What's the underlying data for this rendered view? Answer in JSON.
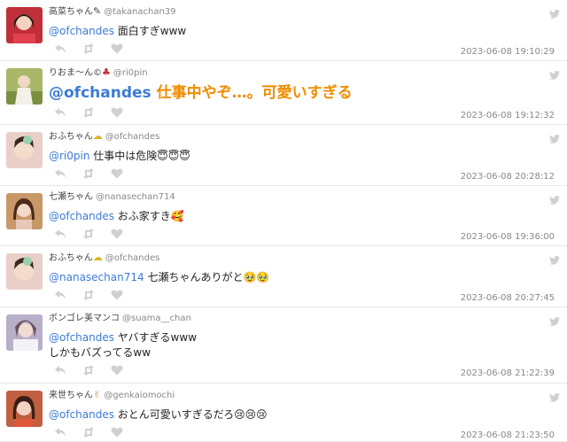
{
  "tweets": [
    {
      "name": "高菜ちゃん",
      "name_emoji": "✎",
      "handle": "@takanachan39",
      "mention": "@ofchandes",
      "text": " 面白すぎwww",
      "time": "2023-06-08 19:10:29",
      "avatar_color": "#c0303a"
    },
    {
      "name": "りおま〜ん©",
      "name_emoji": "♣",
      "handle": "@ri0pin",
      "mention": "@ofchandes",
      "text": " 仕事中やぞ…。可愛いすぎる",
      "time": "2023-06-08 19:12:32",
      "avatar_color": "#a8b868"
    },
    {
      "name": "おふちゃん",
      "name_emoji": "☁",
      "handle": "@ofchandes",
      "mention": "@ri0pin",
      "text": " 仕事中は危険😇😇😇",
      "time": "2023-06-08 20:28:12",
      "avatar_color": "#d8b8a8"
    },
    {
      "name": "七瀬ちゃん",
      "name_emoji": "",
      "handle": "@nanasechan714",
      "mention": "@ofchandes",
      "text": " おふ家すき🥰",
      "time": "2023-06-08 19:36:00",
      "avatar_color": "#b88858"
    },
    {
      "name": "おふちゃん",
      "name_emoji": "☁",
      "handle": "@ofchandes",
      "mention": "@nanasechan714",
      "text": " 七瀬ちゃんありがと🥹🥹",
      "time": "2023-06-08 20:27:45",
      "avatar_color": "#d8b8a8"
    },
    {
      "name": "ボンゴレ美マンコ",
      "name_emoji": "",
      "handle": "@suama__chan",
      "mention": "@ofchandes",
      "text": " ヤバすぎるwww",
      "text2": "しかもバズってるww",
      "time": "2023-06-08 21:22:39",
      "avatar_color": "#9890b0"
    },
    {
      "name": "来世ちゃん",
      "name_emoji": "✌",
      "handle": "@genkaiomochi",
      "mention": "@ofchandes",
      "text": " おとん可愛いすぎるだろ😢😢😢",
      "time": "2023-06-08 21:23:50",
      "avatar_color": "#c06040"
    }
  ],
  "colors": {
    "mention": "#3b7bd6",
    "highlight_text": "#f08c00",
    "icon_gray": "#d0d0d0"
  }
}
